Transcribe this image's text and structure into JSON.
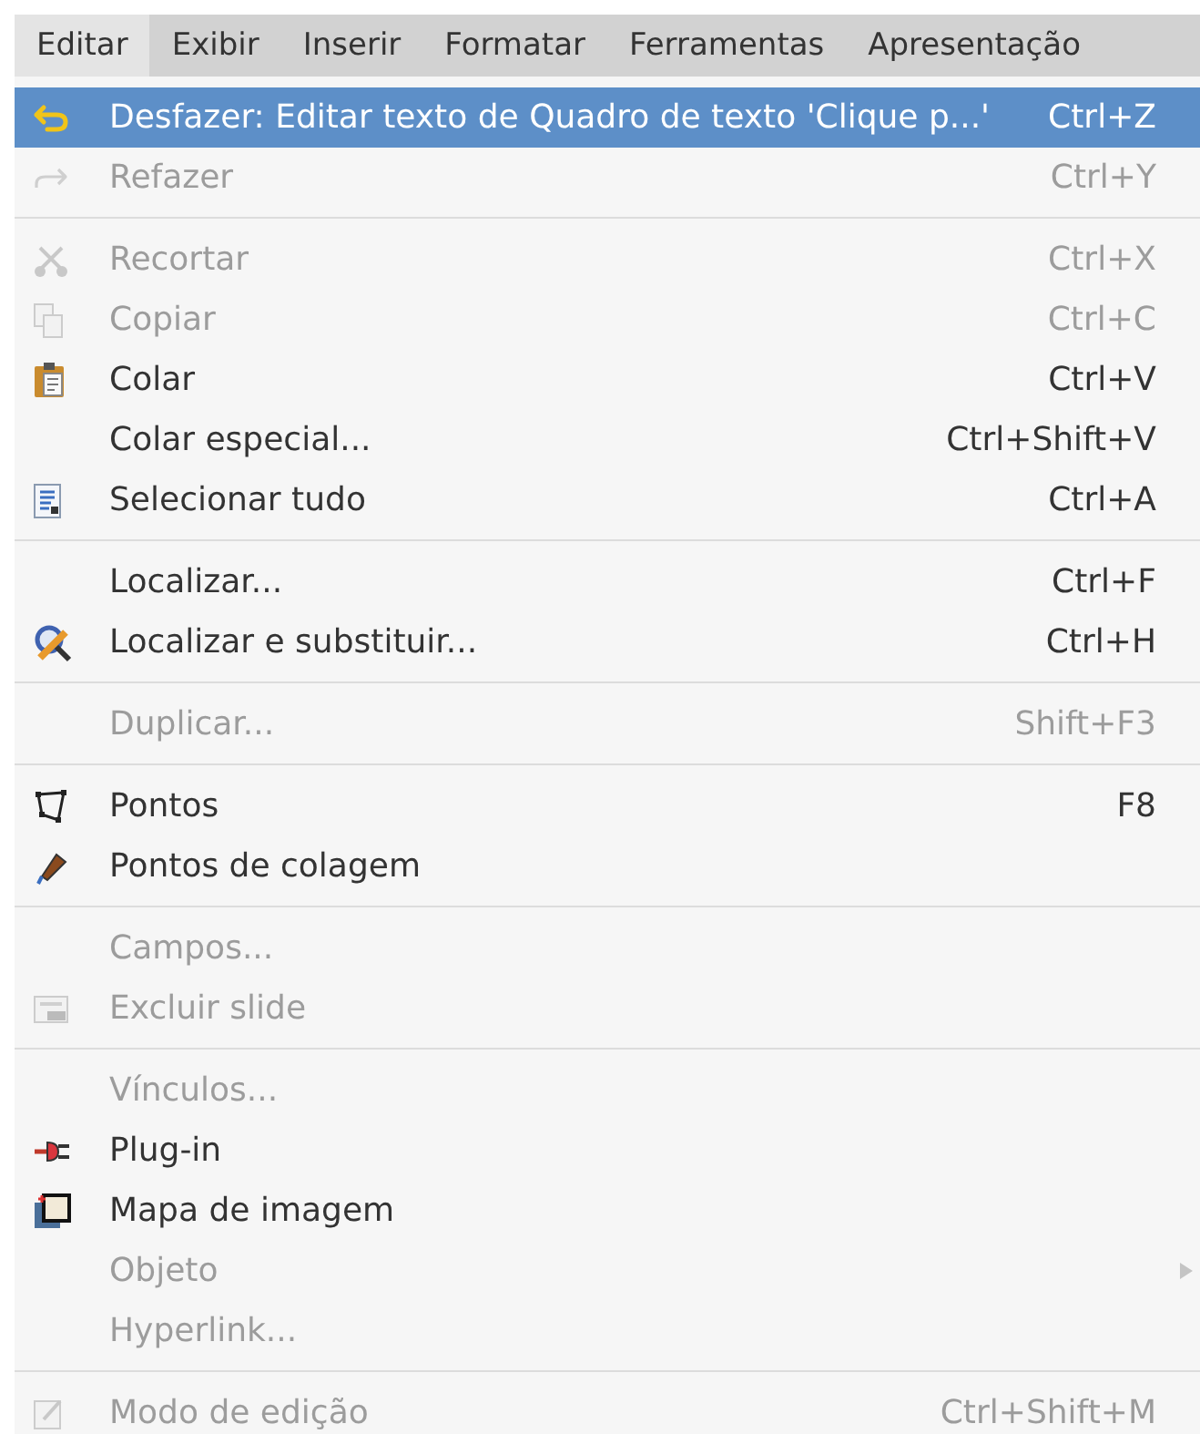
{
  "menubar": [
    {
      "label": "Editar",
      "selected": true
    },
    {
      "label": "Exibir",
      "selected": false
    },
    {
      "label": "Inserir",
      "selected": false
    },
    {
      "label": "Formatar",
      "selected": false
    },
    {
      "label": "Ferramentas",
      "selected": false
    },
    {
      "label": "Apresentação",
      "selected": false
    }
  ],
  "menu": [
    {
      "kind": "item",
      "label": "Desfazer: Editar texto de Quadro de texto 'Clique p...'",
      "shortcut": "Ctrl+Z",
      "disabled": false,
      "selected": true
    },
    {
      "kind": "item",
      "label": "Refazer",
      "shortcut": "Ctrl+Y",
      "disabled": true,
      "selected": false
    },
    {
      "kind": "separator"
    },
    {
      "kind": "item",
      "label": "Recortar",
      "shortcut": "Ctrl+X",
      "disabled": true,
      "selected": false
    },
    {
      "kind": "item",
      "label": "Copiar",
      "shortcut": "Ctrl+C",
      "disabled": true,
      "selected": false
    },
    {
      "kind": "item",
      "label": "Colar",
      "shortcut": "Ctrl+V",
      "disabled": false,
      "selected": false
    },
    {
      "kind": "item",
      "label": "Colar especial...",
      "shortcut": "Ctrl+Shift+V",
      "disabled": false,
      "selected": false
    },
    {
      "kind": "item",
      "label": "Selecionar tudo",
      "shortcut": "Ctrl+A",
      "disabled": false,
      "selected": false
    },
    {
      "kind": "separator"
    },
    {
      "kind": "item",
      "label": "Localizar...",
      "shortcut": "Ctrl+F",
      "disabled": false,
      "selected": false
    },
    {
      "kind": "item",
      "label": "Localizar e substituir...",
      "shortcut": "Ctrl+H",
      "disabled": false,
      "selected": false
    },
    {
      "kind": "separator"
    },
    {
      "kind": "item",
      "label": "Duplicar...",
      "shortcut": "Shift+F3",
      "disabled": true,
      "selected": false
    },
    {
      "kind": "separator"
    },
    {
      "kind": "item",
      "label": "Pontos",
      "shortcut": "F8",
      "disabled": false,
      "selected": false
    },
    {
      "kind": "item",
      "label": "Pontos de colagem",
      "disabled": false,
      "selected": false
    },
    {
      "kind": "separator"
    },
    {
      "kind": "item",
      "label": "Campos...",
      "disabled": true,
      "selected": false
    },
    {
      "kind": "item",
      "label": "Excluir slide",
      "disabled": true,
      "selected": false
    },
    {
      "kind": "separator"
    },
    {
      "kind": "item",
      "label": "Vínculos...",
      "disabled": true,
      "selected": false
    },
    {
      "kind": "item",
      "label": "Plug-in",
      "disabled": false,
      "selected": false
    },
    {
      "kind": "item",
      "label": "Mapa de imagem",
      "disabled": false,
      "selected": false
    },
    {
      "kind": "submenu",
      "label": "Objeto",
      "disabled": true,
      "selected": false
    },
    {
      "kind": "item",
      "label": "Hyperlink...",
      "disabled": true,
      "selected": false
    },
    {
      "kind": "separator"
    },
    {
      "kind": "item",
      "label": "Modo de edição",
      "shortcut": "Ctrl+Shift+M",
      "disabled": true,
      "selected": false
    }
  ]
}
